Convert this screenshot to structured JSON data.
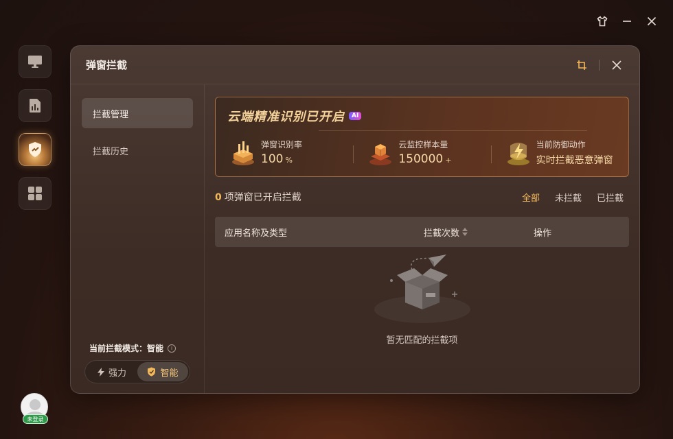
{
  "dialog": {
    "title": "弹窗拦截"
  },
  "sidebar": {
    "items": [
      {
        "label": "拦截管理",
        "active": true
      },
      {
        "label": "拦截历史",
        "active": false
      }
    ],
    "mode_label": "当前拦截模式：智能",
    "info_glyph": "i",
    "modes": [
      {
        "label": "强力",
        "active": false
      },
      {
        "label": "智能",
        "active": true
      }
    ]
  },
  "banner": {
    "title": "云端精准识别已开启",
    "ai_badge": "AI",
    "stats": [
      {
        "label": "弹窗识别率",
        "value": "100",
        "unit": "%"
      },
      {
        "label": "云监控样本量",
        "value": "150000",
        "unit": "+"
      },
      {
        "label": "当前防御动作",
        "value": "实时拦截恶意弹窗"
      }
    ]
  },
  "list": {
    "count": "0",
    "count_suffix": "项弹窗已开启拦截",
    "tabs": [
      {
        "label": "全部",
        "active": true
      },
      {
        "label": "未拦截",
        "active": false
      },
      {
        "label": "已拦截",
        "active": false
      }
    ],
    "columns": {
      "name": "应用名称及类型",
      "count": "拦截次数",
      "op": "操作"
    },
    "empty_text": "暂无匹配的拦截项"
  },
  "user": {
    "badge": "未登录"
  },
  "colors": {
    "accent": "#f2b85c",
    "banner_title": "#f3d19a",
    "user_badge": "#2f9a4a"
  },
  "icons": {
    "rail": [
      "monitor-icon",
      "report-icon",
      "shield-icon",
      "apps-grid-icon"
    ],
    "window": [
      "skin-icon",
      "minimize-icon",
      "close-icon"
    ],
    "dialog": [
      "crop-icon",
      "close-icon"
    ]
  }
}
